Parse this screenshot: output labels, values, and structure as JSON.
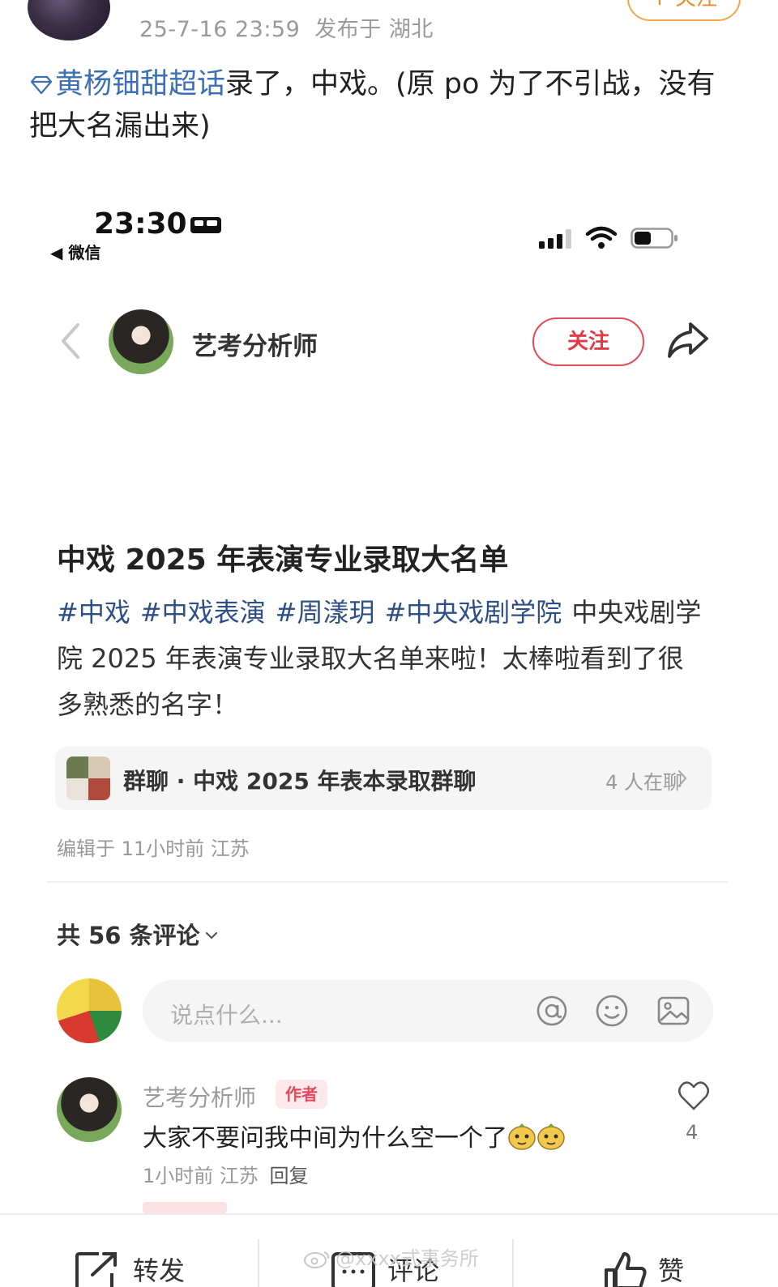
{
  "post": {
    "timestamp": "25-7-16 23:59",
    "location": "发布于 湖北",
    "follow_label": "+ 关注",
    "topic": "黄杨钿甜超话",
    "text": "录了，中戏。(原 po 为了不引战，没有把大名漏出来)"
  },
  "screenshot": {
    "status_bar": {
      "time": "23:30",
      "back_app": "◀ 微信"
    },
    "header": {
      "author": "艺考分析师",
      "follow_label": "关注"
    },
    "note": {
      "title": "中戏 2025 年表演专业录取大名单",
      "tags": [
        "#中戏",
        "#中戏表演",
        "#周漾玥",
        "#中央戏剧学院"
      ],
      "body": "中央戏剧学院 2025 年表演专业录取大名单来啦！太棒啦看到了很多熟悉的名字！"
    },
    "group": {
      "name": "群聊 · 中戏 2025 年表本录取群聊",
      "count": "4 人在聊"
    },
    "edit_info": "编辑于 11小时前 江苏",
    "comments_header": "共 56 条评论",
    "comment_input": {
      "placeholder": "说点什么..."
    },
    "comment": {
      "author": "艺考分析师",
      "badge": "作者",
      "text": "大家不要问我中间为什么空一个了",
      "time": "1小时前 江苏",
      "reply": "回复",
      "likes": "4"
    }
  },
  "bottom_bar": {
    "repost": "转发",
    "comment": "评论",
    "like": "赞"
  },
  "watermark": "@xxxx式事务所",
  "colors": {
    "link": "#3d6fb4",
    "follow_red": "#e23a45",
    "follow_orange": "#f08a24",
    "tag": "#2d4f86"
  }
}
